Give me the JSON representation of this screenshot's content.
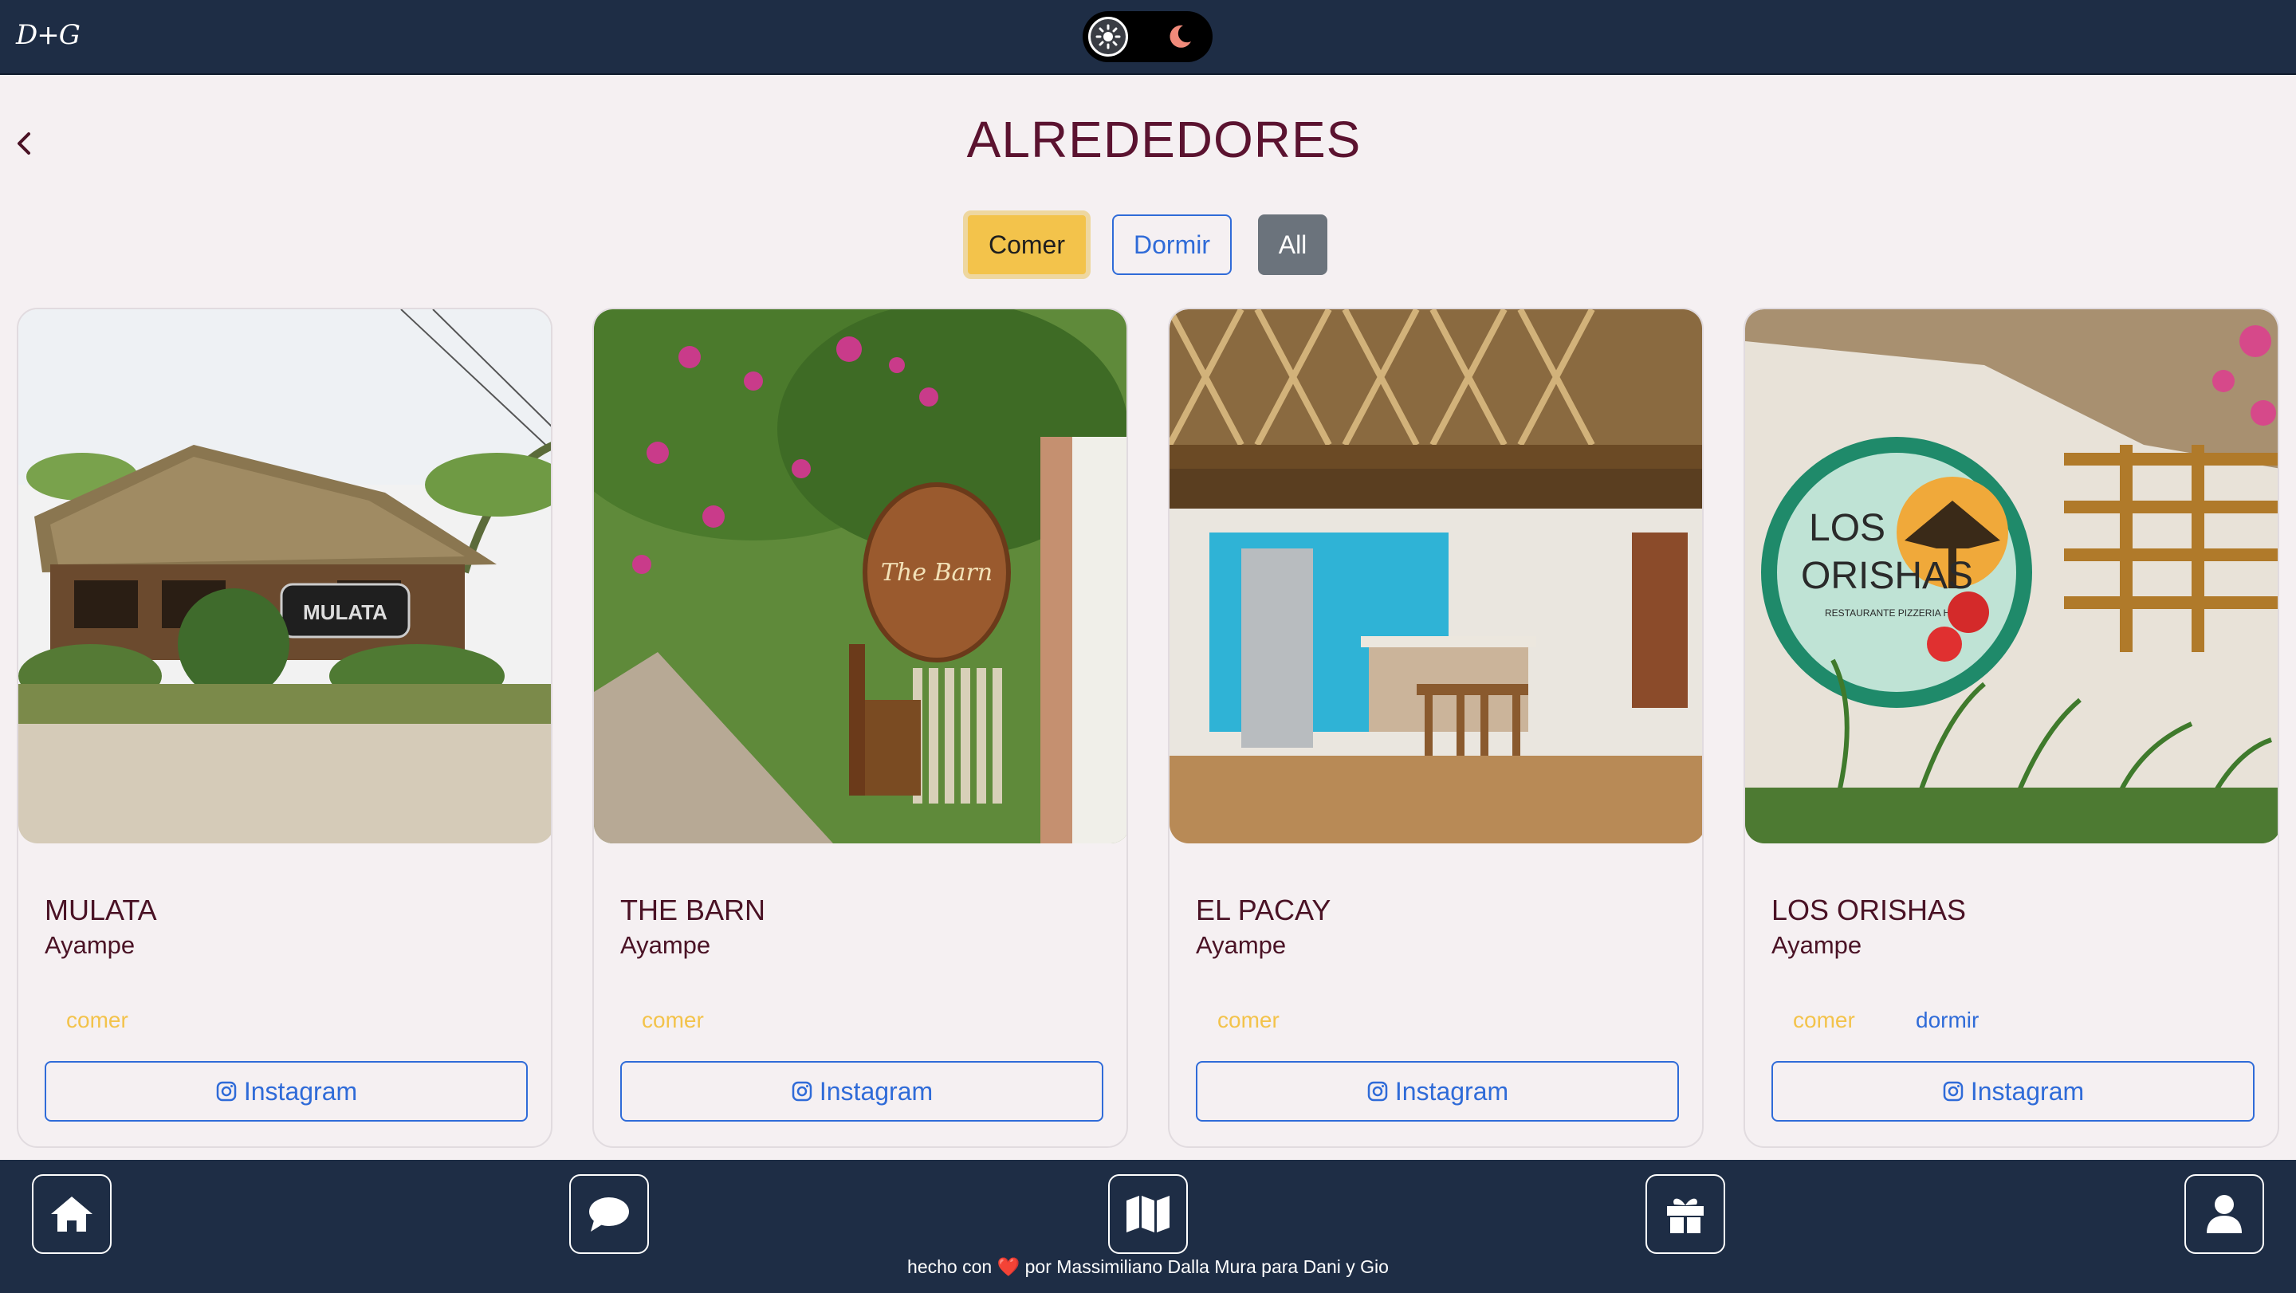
{
  "app": {
    "logo": "D+G"
  },
  "header": {
    "title": "ALREDEDORES"
  },
  "filters": {
    "comer": "Comer",
    "dormir": "Dormir",
    "all": "All"
  },
  "cards": [
    {
      "title": "MULATA",
      "location": "Ayampe",
      "tags": [
        "comer"
      ],
      "button": "Instagram"
    },
    {
      "title": "THE BARN",
      "location": "Ayampe",
      "tags": [
        "comer"
      ],
      "button": "Instagram"
    },
    {
      "title": "EL PACAY",
      "location": "Ayampe",
      "tags": [
        "comer"
      ],
      "button": "Instagram"
    },
    {
      "title": "LOS ORISHAS",
      "location": "Ayampe",
      "tags": [
        "comer",
        "dormir"
      ],
      "button": "Instagram"
    }
  ],
  "images": {
    "mulata_sign": "MULATA",
    "barn_sign": "The Barn",
    "orishas_sign_1": "LOS",
    "orishas_sign_2": "ORISHAS",
    "orishas_sign_3": "RESTAURANTE PIZZERIA HOSTAL"
  },
  "footer": {
    "prefix": "hecho con",
    "heart": "❤️",
    "suffix": "por Massimiliano Dalla Mura para Dani y Gio"
  },
  "colors": {
    "navbar": "#1e2d45",
    "title": "#5b1330",
    "accent_yellow": "#f3c34b",
    "accent_blue": "#2f6bd8",
    "background": "#f5f0f2"
  },
  "icons": [
    "sun-icon",
    "moon-icon",
    "chevron-left-icon",
    "instagram-icon",
    "home-icon",
    "chat-icon",
    "map-icon",
    "gift-icon",
    "user-icon"
  ]
}
